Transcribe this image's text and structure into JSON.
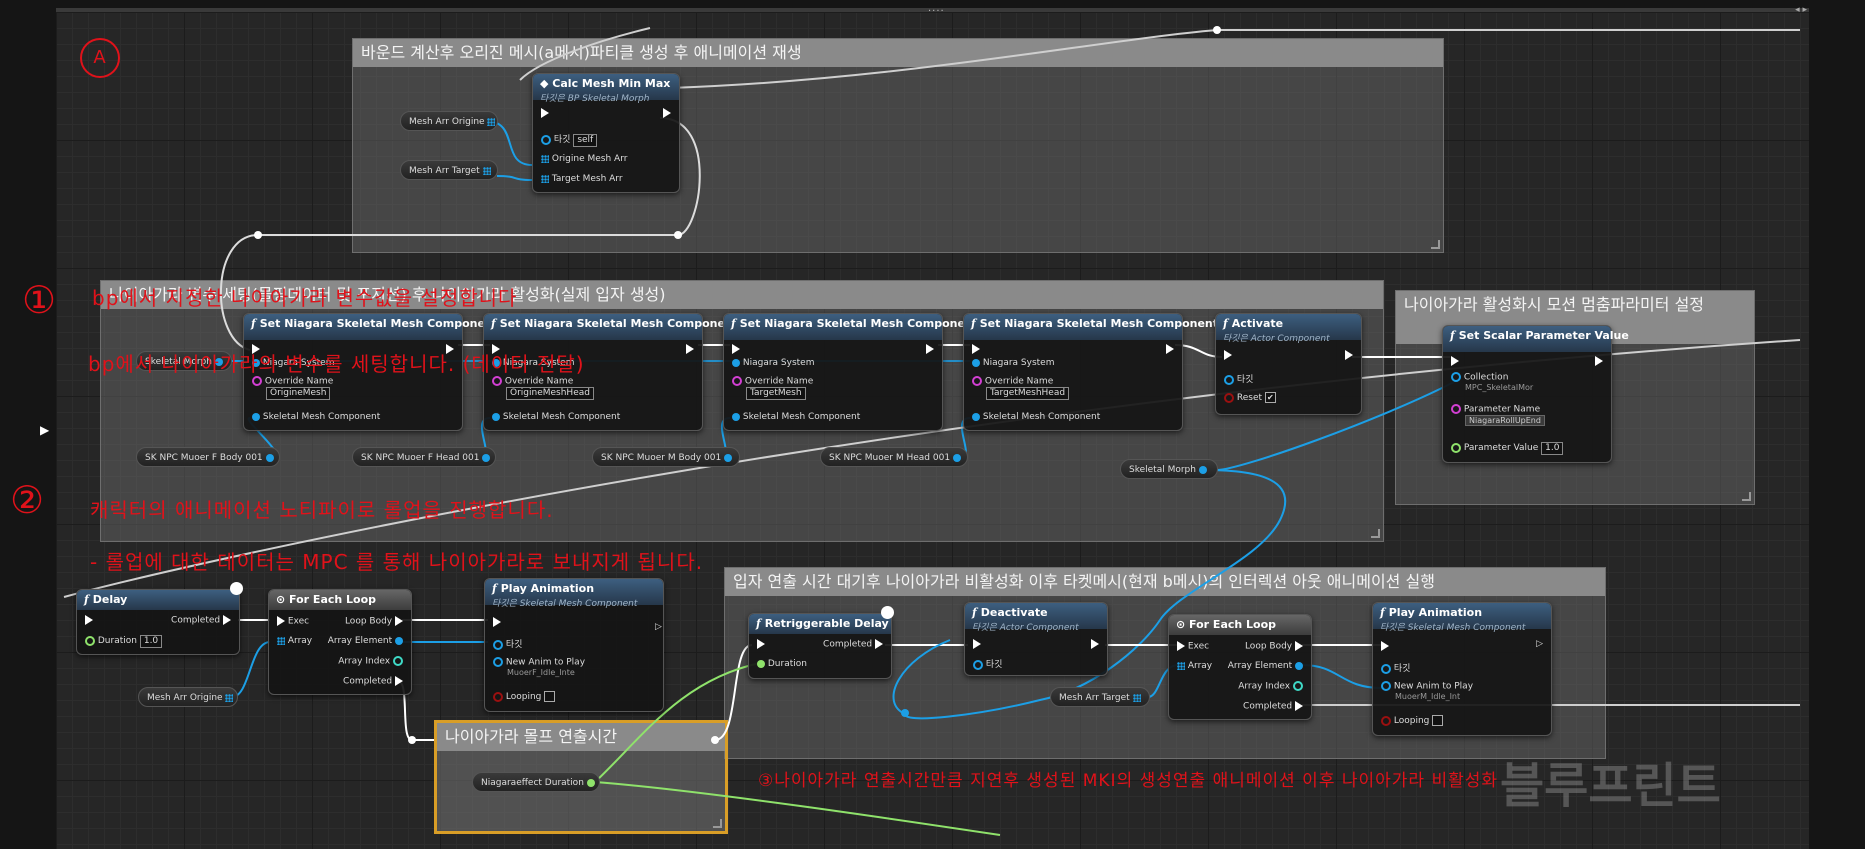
{
  "comments": {
    "bound": "바운드 계산후 오리진 메시(a메시)파티클 생성  후 애니메이션 재생",
    "niagara_set": "나이아가라 변수 세팅(몰핑데이터 및 포지션) 후 나이아가라 활성화(실제 입자 생성)",
    "motion_stop": "나이아가라 활성화시 모션 멈춤파라미터 설정",
    "outro": "입자 연출 시간 대기후 나이아가라 비활성화 이후 타켓메시(현재 b메시)의 인터렉션 아웃 애니메이션 실행",
    "morph_time": "나이아가라 몰프 연출시간"
  },
  "calc_node": {
    "title": "Calc Mesh Min Max",
    "subtitle": "타깃은 BP Skeletal Morph",
    "target": "타깃",
    "self": "self",
    "pin1": "Origine Mesh Arr",
    "pin2": "Target Mesh Arr"
  },
  "vars": {
    "mesh_arr_origine": "Mesh Arr Origine",
    "mesh_arr_target": "Mesh Arr Target",
    "skeletal_morph": "Skeletal Morph",
    "sk_f_body": "SK NPC Muoer F Body 001",
    "sk_f_head": "SK NPC Muoer F Head 001",
    "sk_m_body": "SK NPC Muoer M Body 001",
    "sk_m_head": "SK NPC Muoer M Head 001",
    "niagara_duration": "Niagaraeffect Duration"
  },
  "set_nodes": {
    "title": "Set Niagara Skeletal Mesh Component",
    "niagara_system": "Niagara System",
    "override_name": "Override Name",
    "skeletal_mesh_component": "Skeletal Mesh Component",
    "names": [
      "OrigineMesh",
      "OrigineMeshHead",
      "TargetMesh",
      "TargetMeshHead"
    ]
  },
  "activate": {
    "title": "Activate",
    "subtitle": "타깃은 Actor Component",
    "target": "타깃",
    "reset": "Reset",
    "reset_check": "✔"
  },
  "scalar": {
    "title": "Set Scalar Parameter Value",
    "collection": "Collection",
    "collection_val": "MPC_SkeletalMor",
    "param_name": "Parameter Name",
    "param_name_val": "NiagaraRollUpEnd",
    "param_value": "Parameter Value",
    "param_value_val": "1.0"
  },
  "delay": {
    "title": "Delay",
    "completed": "Completed",
    "duration": "Duration",
    "duration_val": "1.0"
  },
  "for_each_1": {
    "title": "For Each Loop",
    "exec": "Exec",
    "loop_body": "Loop Body",
    "array": "Array",
    "array_element": "Array Element",
    "array_index": "Array Index",
    "completed": "Completed"
  },
  "play_anim_1": {
    "title": "Play Animation",
    "subtitle": "타깃은 Skeletal Mesh Component",
    "target": "타깃",
    "new_anim": "New Anim to Play",
    "anim_val": "MuoerF_Idle_Inte",
    "looping": "Looping"
  },
  "retrig": {
    "title": "Retriggerable Delay",
    "completed": "Completed",
    "duration": "Duration"
  },
  "deactivate": {
    "title": "Deactivate",
    "subtitle": "타깃은 Actor Component",
    "target": "타깃"
  },
  "for_each_2": {
    "title": "For Each Loop",
    "exec": "Exec",
    "loop_body": "Loop Body",
    "array": "Array",
    "array_element": "Array Element",
    "array_index": "Array Index",
    "completed": "Completed"
  },
  "play_anim_2": {
    "title": "Play Animation",
    "subtitle": "타깃은 Skeletal Mesh Component",
    "target": "타깃",
    "new_anim": "New Anim to Play",
    "anim_val": "MuoerM_Idle_Int",
    "looping": "Looping"
  },
  "annotations": {
    "a": "A",
    "one": "①",
    "one_line1": "bp에서  지정한 나이아가라 변수값을 설정합니다",
    "one_line2": "bp에서  나이아가라의 변수를 세팅합니다. (데이터 전달)",
    "two": "②",
    "two_line1": "캐릭터의  애니메이션 노티파이로  롤업을  진행합니다.",
    "two_line2": "- 롤업에 대한  데이터는  MPC 를 통해  나이아가라로  보내지게 됩니다.",
    "three_line": "③나이아가라 연출시간만큼 지연후 생성된  MKI의 생성연출 애니메이션 이후  나이아가라 비활성화"
  },
  "watermark": "블루프린트",
  "topbar": {
    "grip": "····",
    "end": "◂ ▸"
  },
  "icons": {
    "fx": "function-icon",
    "loop": "loop-icon",
    "clock": "clock-icon",
    "calc": "diamond-icon"
  }
}
